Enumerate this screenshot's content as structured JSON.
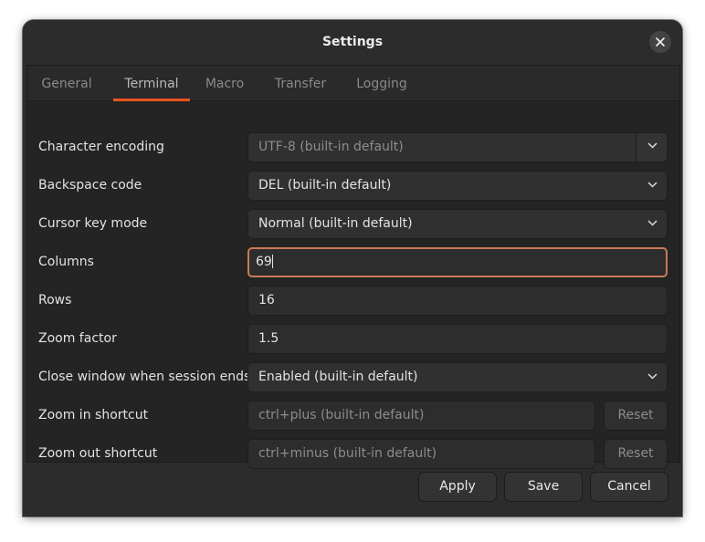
{
  "window": {
    "title": "Settings"
  },
  "tabs": [
    {
      "label": "General",
      "active": false
    },
    {
      "label": "Terminal",
      "active": true
    },
    {
      "label": "Macro",
      "active": false
    },
    {
      "label": "Transfer",
      "active": false
    },
    {
      "label": "Logging",
      "active": false
    }
  ],
  "settings": {
    "character_encoding": {
      "label": "Character encoding",
      "value": "UTF-8 (built-in default)"
    },
    "backspace_code": {
      "label": "Backspace code",
      "value": "DEL (built-in default)"
    },
    "cursor_key_mode": {
      "label": "Cursor key mode",
      "value": "Normal (built-in default)"
    },
    "columns": {
      "label": "Columns",
      "value": "69"
    },
    "rows": {
      "label": "Rows",
      "value": "16"
    },
    "zoom_factor": {
      "label": "Zoom factor",
      "value": "1.5"
    },
    "close_window": {
      "label": "Close window when session ends",
      "value": "Enabled (built-in default)"
    },
    "zoom_in_shortcut": {
      "label": "Zoom in shortcut",
      "placeholder": "ctrl+plus (built-in default)",
      "reset_label": "Reset"
    },
    "zoom_out_shortcut": {
      "label": "Zoom out shortcut",
      "placeholder": "ctrl+minus (built-in default)",
      "reset_label": "Reset"
    }
  },
  "footer": {
    "apply_label": "Apply",
    "save_label": "Save",
    "cancel_label": "Cancel"
  },
  "colors": {
    "accent": "#e95420",
    "focus_border": "#cc7a55"
  },
  "icons": {
    "close": "close-icon",
    "dropdown": "chevron-down-icon"
  }
}
